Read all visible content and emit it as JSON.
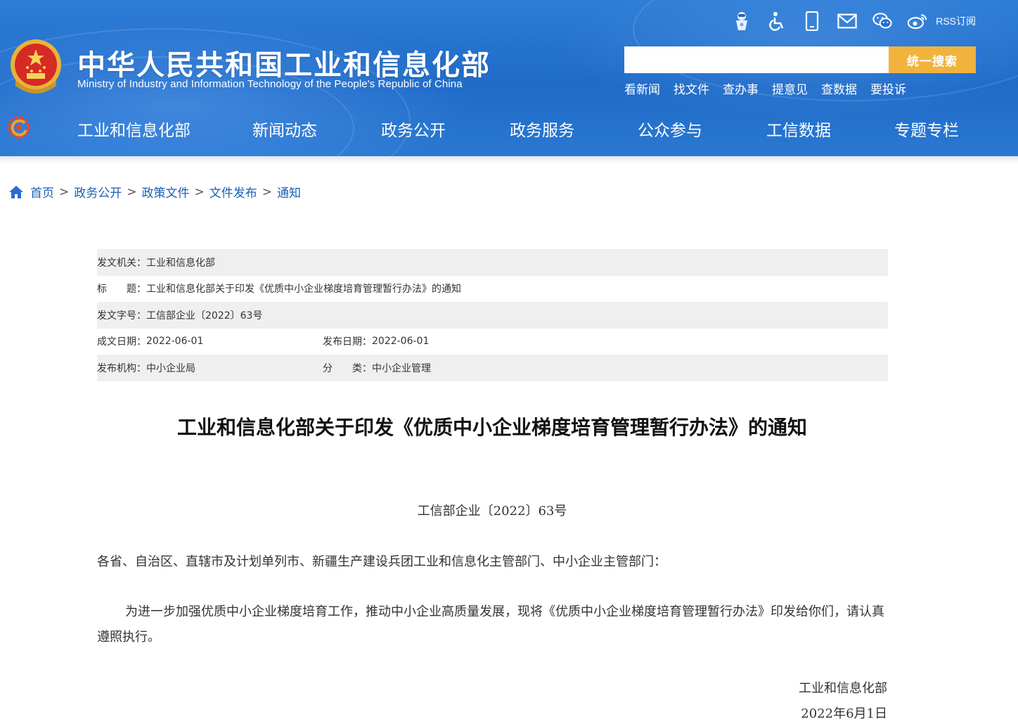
{
  "header": {
    "site_title": "中华人民共和国工业和信息化部",
    "site_subtitle": "Ministry of Industry and Information Technology of the People's Republic of China",
    "util_icons": [
      "robot-assistant-icon",
      "accessibility-icon",
      "mobile-icon",
      "mail-icon",
      "wechat-icon",
      "weibo-icon"
    ],
    "rss_label": "RSS订阅",
    "search": {
      "placeholder": "",
      "value": "",
      "button_label": "统一搜索"
    },
    "quick_links": [
      "看新闻",
      "找文件",
      "查办事",
      "提意见",
      "查数据",
      "要投诉"
    ],
    "nav": [
      "工业和信息化部",
      "新闻动态",
      "政务公开",
      "政务服务",
      "公众参与",
      "工信数据",
      "专题专栏"
    ],
    "colors": {
      "header_blue": "#1f6bc8",
      "search_button": "#f2b33d"
    }
  },
  "breadcrumb": {
    "items": [
      "首页",
      "政务公开",
      "政策文件",
      "文件发布",
      "通知"
    ],
    "separator": ">"
  },
  "meta": {
    "issuer_label": "发文机关：",
    "issuer": "工业和信息化部",
    "title_label": "标　　题：",
    "title": "工业和信息化部关于印发《优质中小企业梯度培育管理暂行办法》的通知",
    "doc_no_label": "发文字号：",
    "doc_no": "工信部企业〔2022〕63号",
    "written_date_label": "成文日期：",
    "written_date": "2022-06-01",
    "publish_date_label": "发布日期：",
    "publish_date": "2022-06-01",
    "publisher_label": "发布机构：",
    "publisher": "中小企业局",
    "category_label": "分　　类：",
    "category": "中小企业管理"
  },
  "article": {
    "title": "工业和信息化部关于印发《优质中小企业梯度培育管理暂行办法》的通知",
    "doc_number": "工信部企业〔2022〕63号",
    "addressee": "各省、自治区、直辖市及计划单列市、新疆生产建设兵团工业和信息化主管部门、中小企业主管部门：",
    "paragraph": "为进一步加强优质中小企业梯度培育工作，推动中小企业高质量发展，现将《优质中小企业梯度培育管理暂行办法》印发给你们，请认真遵照执行。",
    "signature_org": "工业和信息化部",
    "signature_date": "2022年6月1日"
  }
}
